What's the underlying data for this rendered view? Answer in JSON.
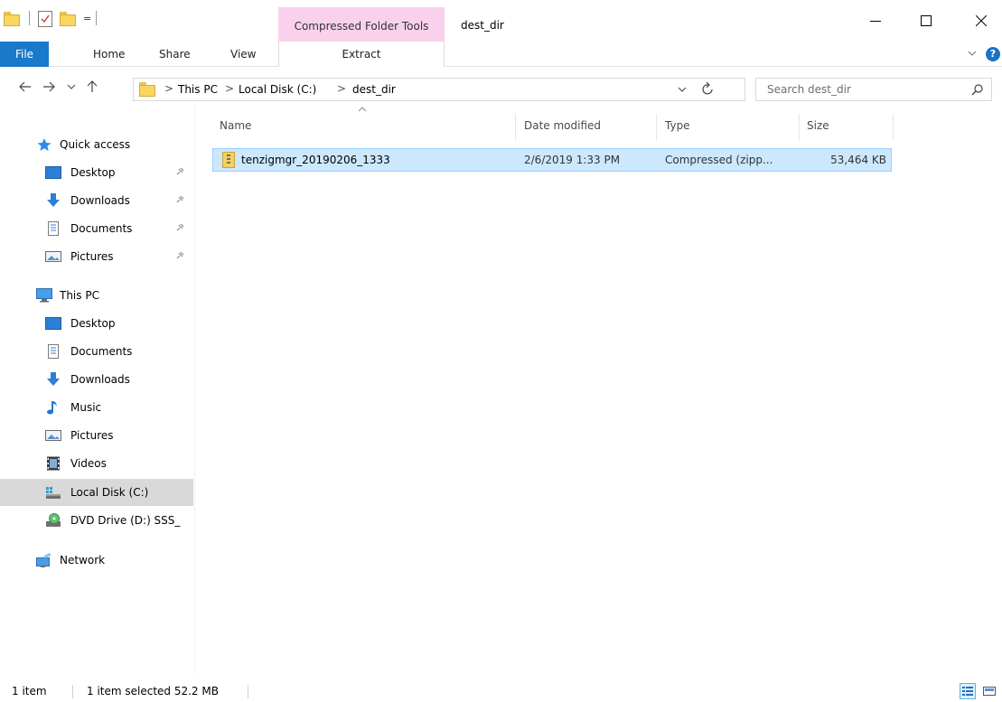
{
  "window": {
    "title": "dest_dir",
    "context_tab_group": "Compressed Folder Tools"
  },
  "quick_access_toolbar": {
    "dropdown": "="
  },
  "ribbon": {
    "tabs": [
      {
        "label": "File"
      },
      {
        "label": "Home"
      },
      {
        "label": "Share"
      },
      {
        "label": "View"
      },
      {
        "label": "Extract"
      }
    ]
  },
  "address": {
    "breadcrumbs": [
      "This PC",
      "Local Disk (C:)",
      "dest_dir"
    ],
    "separator": ">",
    "search_placeholder": "Search dest_dir"
  },
  "nav": {
    "quick_access": {
      "label": "Quick access"
    },
    "pinned": [
      {
        "label": "Desktop",
        "icon": "desktop-icon"
      },
      {
        "label": "Downloads",
        "icon": "downloads-icon"
      },
      {
        "label": "Documents",
        "icon": "documents-icon"
      },
      {
        "label": "Pictures",
        "icon": "pictures-icon"
      }
    ],
    "this_pc": {
      "label": "This PC"
    },
    "pc_items": [
      {
        "label": "Desktop",
        "icon": "desktop-icon"
      },
      {
        "label": "Documents",
        "icon": "documents-icon"
      },
      {
        "label": "Downloads",
        "icon": "downloads-icon"
      },
      {
        "label": "Music",
        "icon": "music-icon"
      },
      {
        "label": "Pictures",
        "icon": "pictures-icon"
      },
      {
        "label": "Videos",
        "icon": "videos-icon"
      },
      {
        "label": "Local Disk (C:)",
        "icon": "local-disk-icon",
        "selected": true
      },
      {
        "label": "DVD Drive (D:) SSS_",
        "icon": "dvd-drive-icon"
      }
    ],
    "network": {
      "label": "Network"
    }
  },
  "columns": {
    "name": "Name",
    "date_modified": "Date modified",
    "type": "Type",
    "size": "Size"
  },
  "files": [
    {
      "name": "tenzigmgr_20190206_1333",
      "date_modified": "2/6/2019 1:33 PM",
      "type": "Compressed (zipp...",
      "size": "53,464 KB",
      "selected": true
    }
  ],
  "status": {
    "item_count": "1 item",
    "selection": "1 item selected  52.2 MB"
  },
  "colors": {
    "file_tab": "#1979ca",
    "context_tab": "#f9d1ec",
    "selection_bg": "#cce8ff",
    "selection_border": "#99d1ff",
    "nav_selected": "#d9d9d9"
  }
}
